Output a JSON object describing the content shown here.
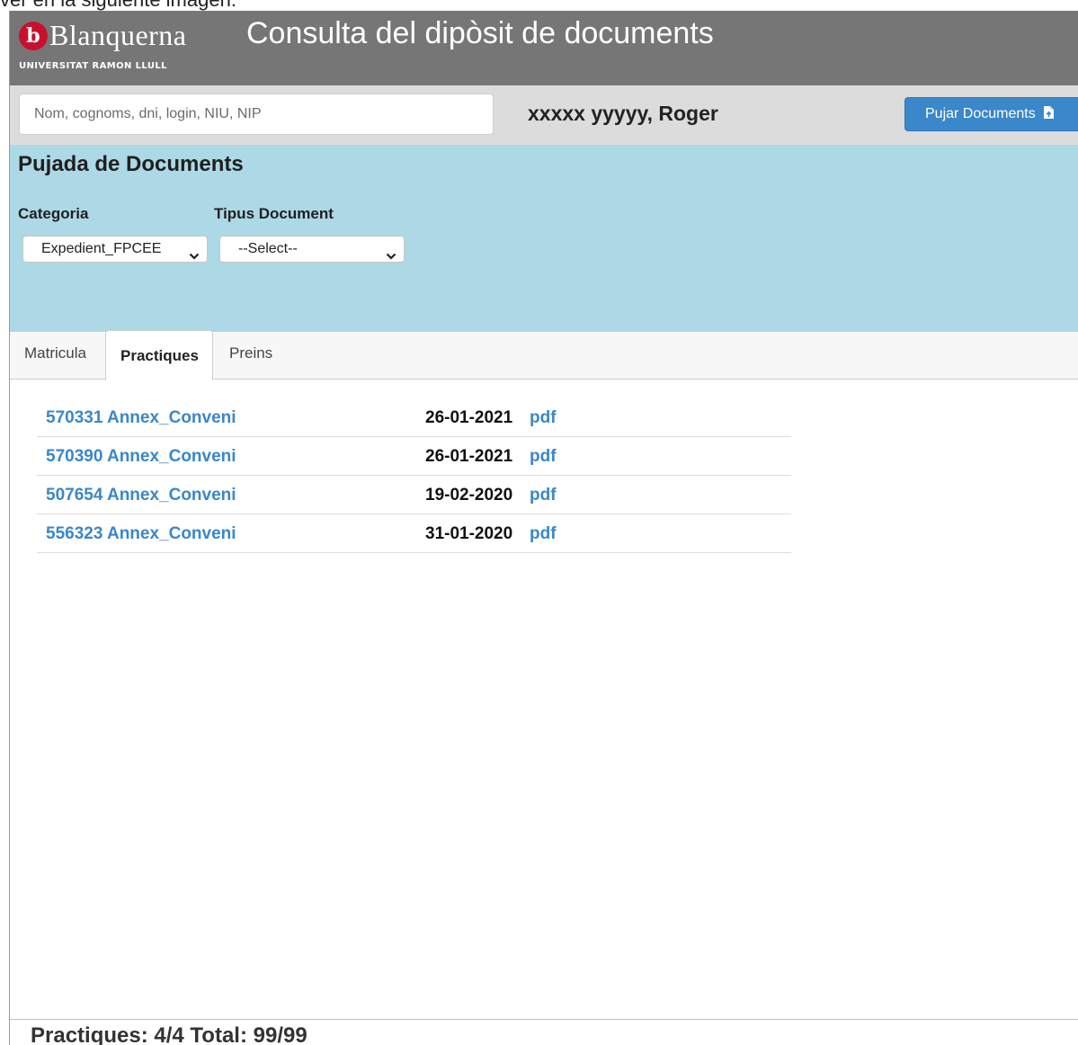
{
  "caption": "ver en la siguiente imagen:",
  "header": {
    "brand_mark": "b",
    "brand_name": "Blanquerna",
    "brand_subtitle": "UNIVERSITAT RAMON LLULL",
    "title": "Consulta del dipòsit de documents"
  },
  "search": {
    "placeholder": "Nom, cognoms, dni, login, NIU, NIP",
    "value": ""
  },
  "user": {
    "name": "xxxxx yyyyy, Roger"
  },
  "upload_button": {
    "label": "Pujar Documents",
    "icon": "file-upload-icon"
  },
  "upload_panel": {
    "title": "Pujada de Documents",
    "category": {
      "label": "Categoria",
      "selected": "Expedient_FPCEE"
    },
    "doc_type": {
      "label": "Tipus Document",
      "selected": "--Select--"
    }
  },
  "tabs": [
    {
      "label": "Matricula",
      "active": false
    },
    {
      "label": "Practiques",
      "active": true
    },
    {
      "label": "Preins",
      "active": false
    }
  ],
  "documents": [
    {
      "name": "570331 Annex_Conveni",
      "date": "26-01-2021",
      "format": "pdf"
    },
    {
      "name": "570390 Annex_Conveni",
      "date": "26-01-2021",
      "format": "pdf"
    },
    {
      "name": "507654 Annex_Conveni",
      "date": "19-02-2020",
      "format": "pdf"
    },
    {
      "name": "556323 Annex_Conveni",
      "date": "31-01-2020",
      "format": "pdf"
    }
  ],
  "footer": {
    "summary": "Practiques: 4/4 Total: 99/99"
  },
  "colors": {
    "header_bg": "#767676",
    "panel_bg": "#add8e6",
    "accent": "#3a87c9",
    "brand_red": "#c8102e"
  }
}
